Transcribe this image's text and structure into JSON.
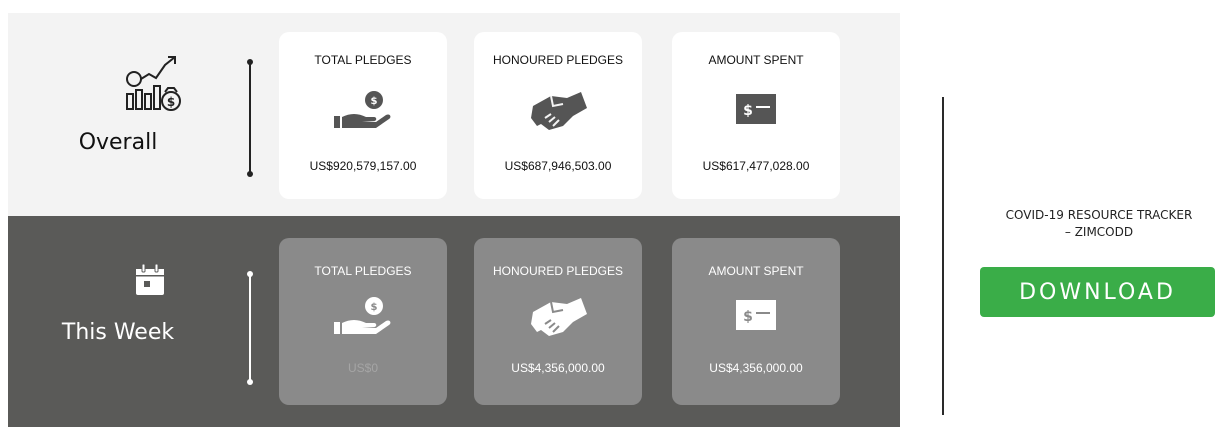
{
  "overall": {
    "label": "Overall",
    "icon": "growth-chart-money-icon",
    "cards": [
      {
        "title": "TOTAL PLEDGES",
        "icon": "hand-coin-icon",
        "value": "US$920,579,157.00"
      },
      {
        "title": "HONOURED PLEDGES",
        "icon": "handshake-icon",
        "value": "US$687,946,503.00"
      },
      {
        "title": "AMOUNT SPENT",
        "icon": "dollar-bill-icon",
        "value": "US$617,477,028.00"
      }
    ]
  },
  "week": {
    "label": "This Week",
    "icon": "calendar-icon",
    "cards": [
      {
        "title": "TOTAL PLEDGES",
        "icon": "hand-coin-icon",
        "value": "US$0"
      },
      {
        "title": "HONOURED PLEDGES",
        "icon": "handshake-icon",
        "value": "US$4,356,000.00"
      },
      {
        "title": "AMOUNT SPENT",
        "icon": "dollar-bill-icon",
        "value": "US$4,356,000.00"
      }
    ]
  },
  "tracker": {
    "title_line1": "COVID-19 RESOURCE TRACKER",
    "title_line2": "– ZIMCODD",
    "download_label": "DOWNLOAD"
  },
  "colors": {
    "overall_bg": "#f3f3f3",
    "week_bg": "#5a5a58",
    "week_card_bg": "#8a8a8a",
    "download_green": "#3aad48"
  }
}
